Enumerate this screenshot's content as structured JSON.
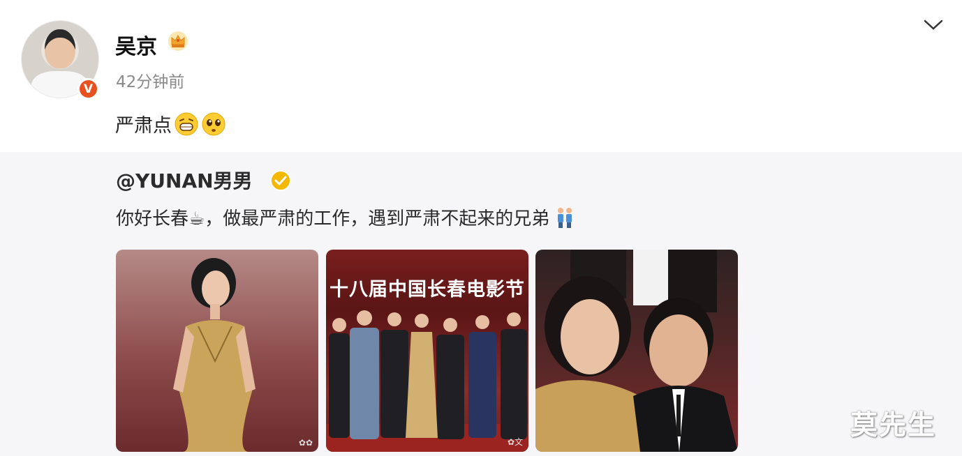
{
  "post": {
    "username": "吴京",
    "timestamp": "42分钟前",
    "text": "严肃点",
    "verified_mark": "V"
  },
  "repost": {
    "author": "@YUNAN男男",
    "text": "你好长春☕，做最严肃的工作，遇到严肃不起来的兄弟"
  },
  "photo2": {
    "banner": "十八届中国长春电影节"
  },
  "watermark": "莫先生",
  "colors": {
    "accent": "#e8501f",
    "verify_yellow": "#f5b800",
    "repost_bg": "#f6f6f8"
  }
}
